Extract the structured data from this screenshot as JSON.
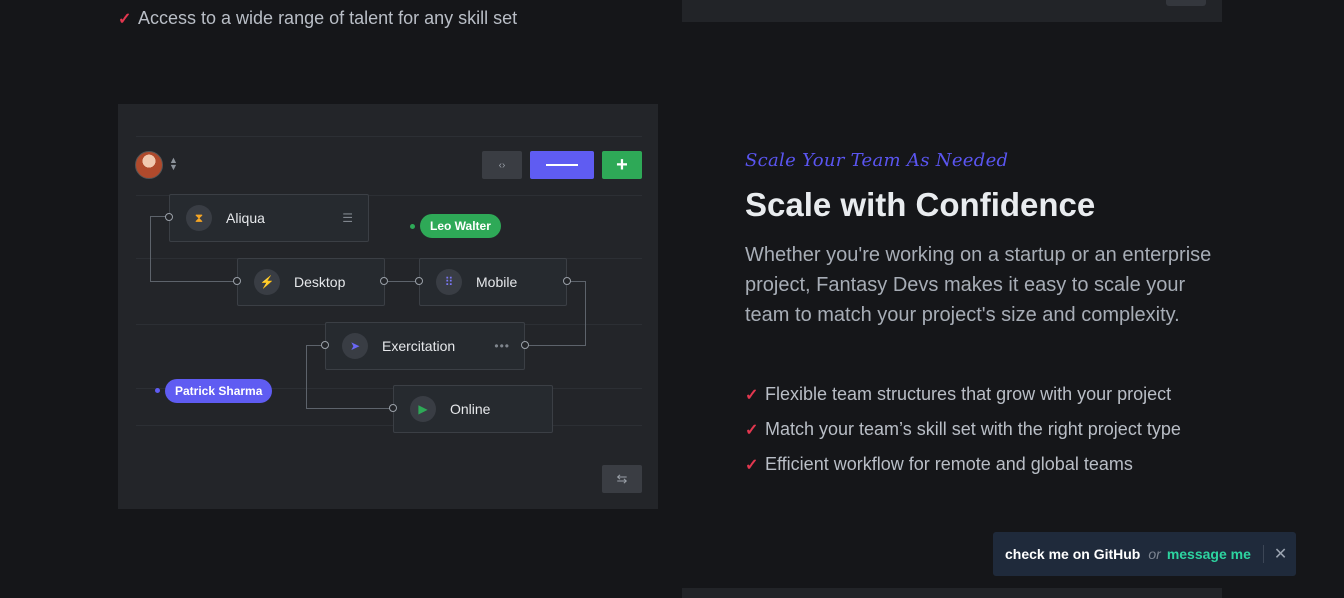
{
  "top_item": {
    "check": "✓",
    "text": "Access to a wide range of talent for any skill set"
  },
  "illustration": {
    "nodes": {
      "aliqua": "Aliqua",
      "desktop": "Desktop",
      "mobile": "Mobile",
      "exercitation": "Exercitation",
      "online": "Online"
    },
    "tags": {
      "leo": "Leo Walter",
      "patrick": "Patrick Sharma"
    },
    "buttons": {
      "code": "‹›",
      "add": "+",
      "filter": "⇆"
    },
    "trails": {
      "aliqua": "☰",
      "exercitation": "•••"
    },
    "icons": {
      "aliqua": "⧗",
      "desktop": "⚡",
      "mobile": "⠿",
      "exercitation": "➤",
      "online": "▶"
    }
  },
  "section": {
    "eyebrow": "Scale Your Team As Needed",
    "title": "Scale with Confidence",
    "description": "Whether you're working on a startup or an enterprise project, Fantasy Devs makes it easy to scale your team to match your project's size and complexity.",
    "features": [
      "Flexible team structures that grow with your project",
      "Match your team’s skill set with the right project type",
      "Efficient workflow for remote and global teams"
    ],
    "check": "✓"
  },
  "toast": {
    "github": "check me on GitHub",
    "or": "or",
    "message": "message me",
    "close": "✕"
  },
  "colors": {
    "accent": "#5f5cf2",
    "check": "#e2374f",
    "green": "#2ea957",
    "toast_link": "#2dd4a0"
  }
}
